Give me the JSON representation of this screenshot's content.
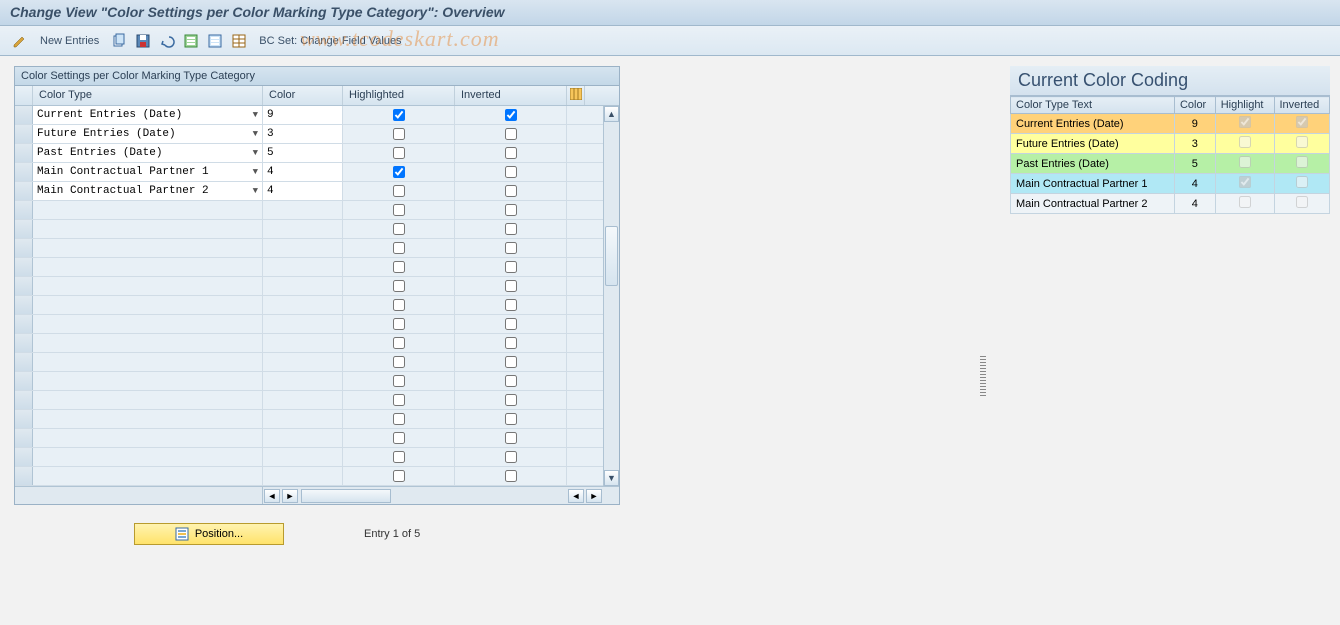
{
  "title": "Change View \"Color Settings per Color Marking Type Category\": Overview",
  "watermark": "www.tcodeskart.com",
  "toolbar": {
    "new_entries": "New Entries",
    "bc_set": "BC Set: Change Field Values"
  },
  "grid": {
    "title": "Color Settings per Color Marking Type Category",
    "headers": {
      "color_type": "Color Type",
      "color": "Color",
      "highlighted": "Highlighted",
      "inverted": "Inverted"
    },
    "rows": [
      {
        "color_type": "Current Entries (Date)",
        "color": "9",
        "highlighted": true,
        "inverted": true
      },
      {
        "color_type": "Future Entries (Date)",
        "color": "3",
        "highlighted": false,
        "inverted": false
      },
      {
        "color_type": "Past Entries (Date)",
        "color": "5",
        "highlighted": false,
        "inverted": false
      },
      {
        "color_type": "Main Contractual Partner 1",
        "color": "4",
        "highlighted": true,
        "inverted": false
      },
      {
        "color_type": "Main Contractual Partner 2",
        "color": "4",
        "highlighted": false,
        "inverted": false
      }
    ],
    "empty_rows": 15
  },
  "footer": {
    "position_btn": "Position...",
    "entry_text": "Entry 1 of 5"
  },
  "right_panel": {
    "title": "Current Color Coding",
    "headers": {
      "text": "Color Type Text",
      "color": "Color",
      "highlight": "Highlight",
      "inverted": "Inverted"
    },
    "rows": [
      {
        "text": "Current Entries (Date)",
        "color": "9",
        "highlight": true,
        "inverted": true,
        "class": "row-orange"
      },
      {
        "text": "Future Entries (Date)",
        "color": "3",
        "highlight": false,
        "inverted": false,
        "class": "row-yellow"
      },
      {
        "text": "Past Entries (Date)",
        "color": "5",
        "highlight": false,
        "inverted": false,
        "class": "row-green"
      },
      {
        "text": "Main Contractual Partner 1",
        "color": "4",
        "highlight": true,
        "inverted": false,
        "class": "row-cyan"
      },
      {
        "text": "Main Contractual Partner 2",
        "color": "4",
        "highlight": false,
        "inverted": false,
        "class": "row-grey"
      }
    ]
  }
}
